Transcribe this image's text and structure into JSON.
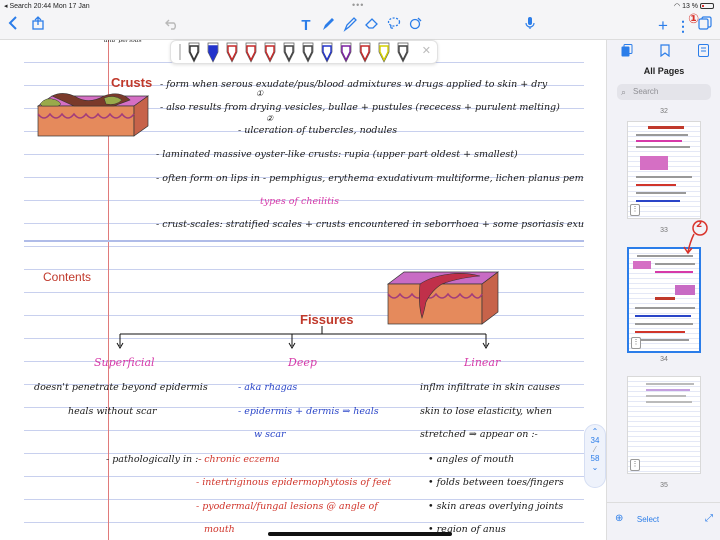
{
  "status": {
    "left": "◂ Search   20:44   Mon 17 Jan",
    "battery": "13 %"
  },
  "toolbar": {
    "back_icon": "chevron-left-icon",
    "share_icon": "share-icon",
    "undo_icon": "undo-icon",
    "tools": [
      "text-tool-icon",
      "pen-tool-icon",
      "highlighter-tool-icon",
      "eraser-tool-icon",
      "lasso-tool-icon",
      "shapes-tool-icon"
    ],
    "mic_icon": "microphone-icon",
    "add": "+",
    "more": "⋮",
    "pages_icon": "pages-icon"
  },
  "pen_colors": [
    "#333333",
    "#2233cc",
    "#c62828",
    "#c62828",
    "#c62828",
    "#444444",
    "#444444",
    "#2233cc",
    "#7b1fa2",
    "#c62828",
    "#d4d000",
    "#444444"
  ],
  "note": {
    "crusts_title": "Crusts",
    "crusts_lines": [
      "- form when serous exudate/pus/blood admixtures w drugs applied to skin + dry",
      "- also results from drying vesicles, bullae + pustules (rececess + purulent melting)",
      "- ulceration of tubercles, nodules",
      "- laminated massive oyster-like crusts: rupia (upper part oldest + smallest)",
      "- often form on lips in - pemphigus, erythema exudativum multiforme, lichen planus pemphigoides,",
      "types of cheilitis",
      "- crust-scales: stratified scales + crusts encountered in seborrhoea + some psoriasis exudativa"
    ],
    "mark_1": "①",
    "mark_2": "②",
    "contents": "Contents",
    "fissures_title": "Fissures",
    "columns": [
      {
        "head": "Superficial",
        "lines": [
          "doesn't penetrate beyond epidermis",
          "heals without scar",
          "- pathologically in :-",
          "- chronic eczema",
          "- intertriginous epidermophytosis of feet",
          "- pyodermal/fungal lesions @ angle of",
          "mouth"
        ]
      },
      {
        "head": "Deep",
        "lines": [
          "- aka rhagas",
          "- epidermis + dermis ⇒ heals",
          "w scar"
        ]
      },
      {
        "head": "Linear",
        "lines": [
          "inflm infiltrate in skin causes",
          "skin to lose elasticity, when",
          "stretched ⇒ appear on :-",
          "• angles of mouth",
          "• folds between toes/fingers",
          "• skin areas overlying joints",
          "• region of anus"
        ]
      }
    ]
  },
  "scroll": {
    "current": "34",
    "total": "58"
  },
  "sidebar": {
    "title": "All Pages",
    "search_placeholder": "Search",
    "pages": [
      "32",
      "33",
      "34",
      "35"
    ],
    "selected_page": "34",
    "select_label": "Select"
  },
  "annotations": {
    "a": "①",
    "b": "②"
  }
}
